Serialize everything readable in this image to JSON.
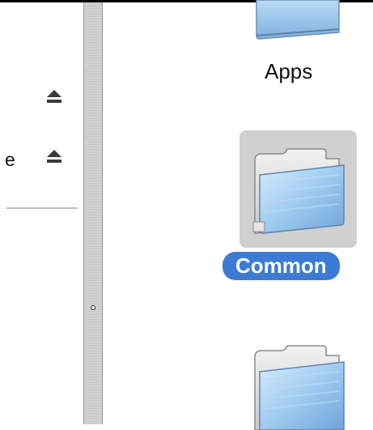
{
  "sidebar": {
    "items": [
      {
        "label": "",
        "eject_icon": "eject-icon"
      },
      {
        "label": "e",
        "eject_icon": "eject-icon"
      }
    ]
  },
  "content": {
    "items": [
      {
        "label": "Apps",
        "icon": "folder-icon",
        "selected": false
      },
      {
        "label": "Common",
        "icon": "folder-icon",
        "selected": true
      },
      {
        "label": "",
        "icon": "folder-icon",
        "selected": false
      }
    ]
  },
  "colors": {
    "selection": "#3b7bd6",
    "selection_background": "#d0d0d0",
    "folder_blue": "#8fc0ea"
  }
}
